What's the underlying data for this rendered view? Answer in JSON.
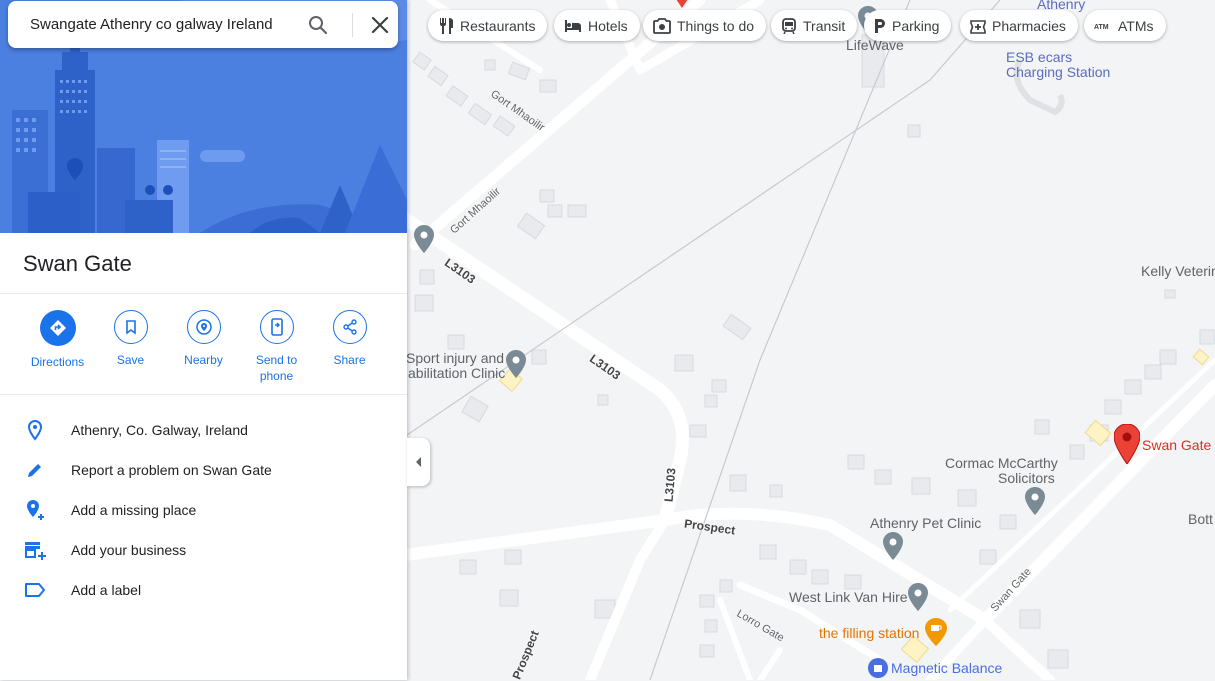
{
  "search": {
    "value": "Swangate Athenry co galway Ireland"
  },
  "chips": [
    {
      "label": "Restaurants",
      "icon": "restaurant-icon"
    },
    {
      "label": "Hotels",
      "icon": "hotel-icon"
    },
    {
      "label": "Things to do",
      "icon": "camera-icon"
    },
    {
      "label": "Transit",
      "icon": "transit-icon"
    },
    {
      "label": "Parking",
      "icon": "parking-icon"
    },
    {
      "label": "Pharmacies",
      "icon": "pharmacy-icon"
    },
    {
      "label": "ATMs",
      "icon": "atm-icon"
    }
  ],
  "place": {
    "title": "Swan Gate"
  },
  "actions": [
    {
      "label": "Directions",
      "icon": "directions-icon"
    },
    {
      "label": "Save",
      "icon": "bookmark-icon"
    },
    {
      "label": "Nearby",
      "icon": "nearby-icon"
    },
    {
      "label": "Send to phone",
      "icon": "send-to-phone-icon"
    },
    {
      "label": "Share",
      "icon": "share-icon"
    }
  ],
  "info": [
    {
      "label": "Athenry, Co. Galway, Ireland",
      "icon": "location-pin-icon"
    },
    {
      "label": "Report a problem on Swan Gate",
      "icon": "pencil-icon"
    },
    {
      "label": "Add a missing place",
      "icon": "add-place-icon"
    },
    {
      "label": "Add your business",
      "icon": "add-business-icon"
    },
    {
      "label": "Add a label",
      "icon": "label-icon"
    }
  ],
  "map": {
    "places": {
      "lifewave": "LifeWave",
      "esb_line1": "ESB ecars",
      "esb_line2": "Charging Station",
      "athenry_top": "Athenry",
      "kelly": "Kelly Veterin",
      "sport1": "Sport injury and",
      "sport2": "abilitation Clinic",
      "cormac1": "Cormac McCarthy",
      "cormac2": "Solicitors",
      "pet": "Athenry Pet Clinic",
      "westlink": "West Link Van Hire",
      "filling": "the filling station",
      "magnetic": "Magnetic Balance",
      "bott": "Bott",
      "swan_gate_pin": "Swan Gate"
    },
    "roads": {
      "gort1": "Gort Mhaoilir",
      "gort2": "Gort Mhaoilir",
      "l3103_a": "L3103",
      "l3103_b": "L3103",
      "l3103_c": "L3103",
      "prospect_a": "Prospect",
      "prospect_b": "Prospect",
      "lorro": "Lorro Gate",
      "swangate_road": "Swan Gate"
    }
  },
  "colors": {
    "accent": "#1a73e8",
    "pin_red": "#ea4335",
    "poi_gray": "#7a8b96",
    "food_orange": "#f29900"
  }
}
